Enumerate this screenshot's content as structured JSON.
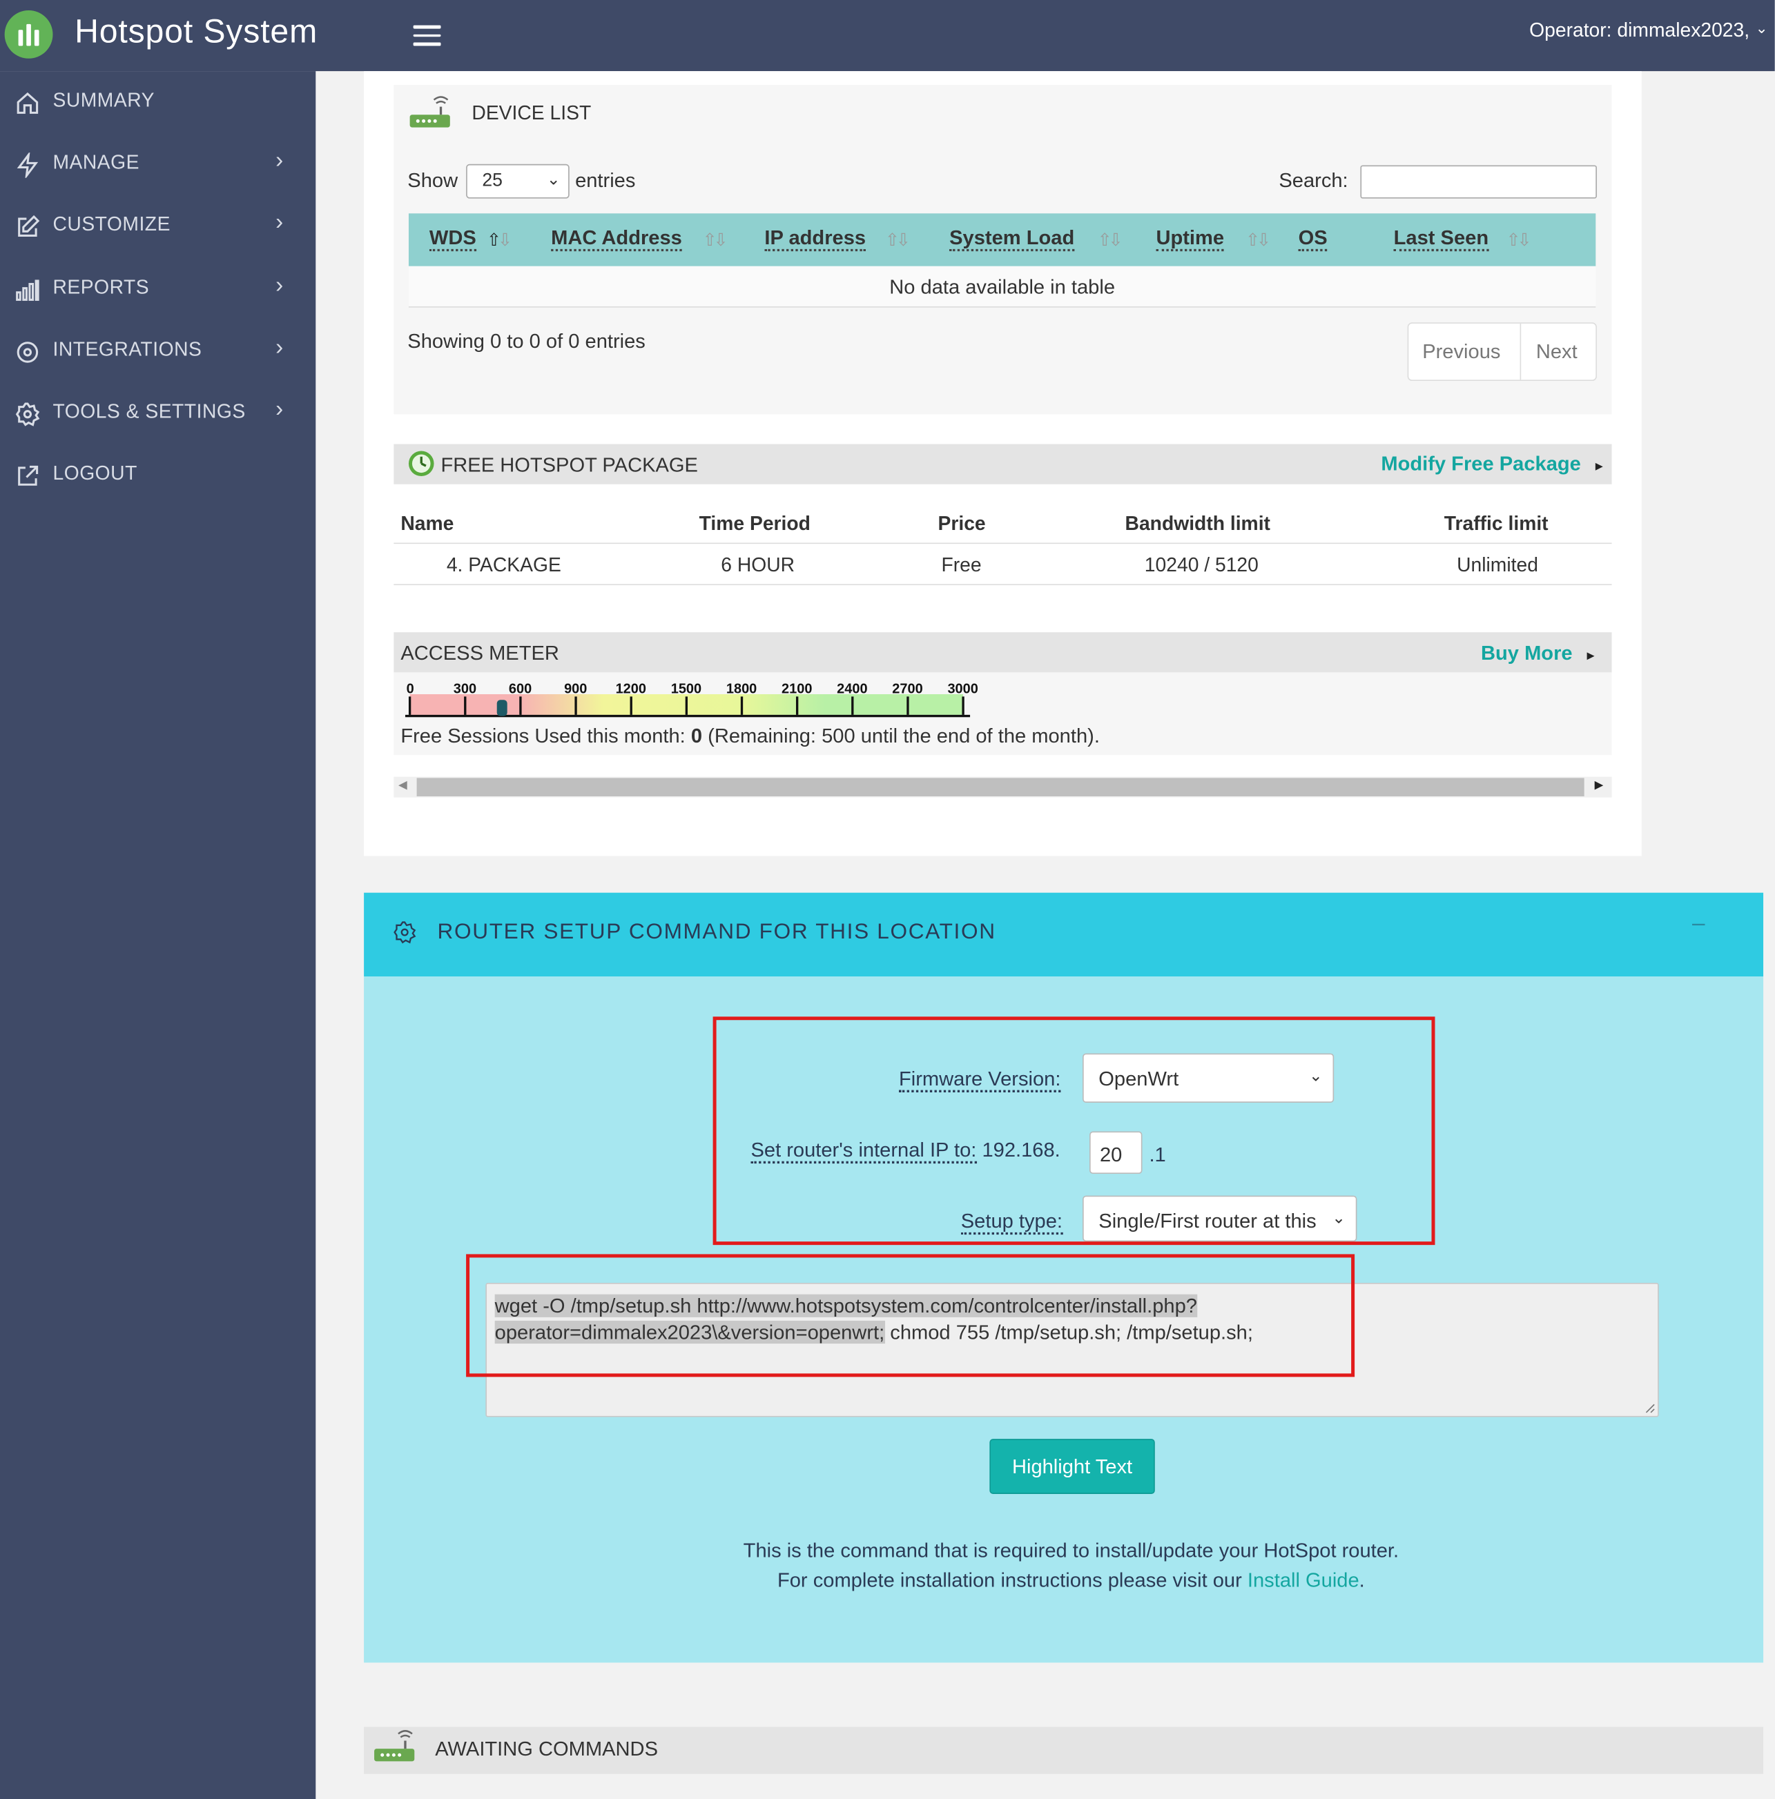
{
  "app": {
    "title": "Hotspot System",
    "operator": "Operator: dimmalex2023,"
  },
  "sidebar": {
    "items": [
      {
        "label": "SUMMARY",
        "icon": "home-icon"
      },
      {
        "label": "MANAGE",
        "icon": "lightning-icon"
      },
      {
        "label": "CUSTOMIZE",
        "icon": "edit-icon"
      },
      {
        "label": "REPORTS",
        "icon": "bar-chart-icon"
      },
      {
        "label": "INTEGRATIONS",
        "icon": "target-icon"
      },
      {
        "label": "TOOLS & SETTINGS",
        "icon": "gear-icon"
      },
      {
        "label": "LOGOUT",
        "icon": "external-link-icon"
      }
    ]
  },
  "device_list": {
    "title": "DEVICE LIST",
    "show_label": "Show",
    "entries_value": "25",
    "entries_label": "entries",
    "search_label": "Search:",
    "search_value": "",
    "columns": [
      "WDS",
      "MAC Address",
      "IP address",
      "System Load",
      "Uptime",
      "OS",
      "Last Seen"
    ],
    "sort_icon": "⇧⇩",
    "empty_text": "No data available in table",
    "info_text": "Showing 0 to 0 of 0 entries",
    "prev_label": "Previous",
    "next_label": "Next"
  },
  "free_package": {
    "title": "FREE HOTSPOT PACKAGE",
    "modify_label": "Modify Free Package",
    "columns": [
      "Name",
      "Time Period",
      "Price",
      "Bandwidth limit",
      "Traffic limit"
    ],
    "row": [
      "4. PACKAGE",
      "6 HOUR",
      "Free",
      "10240 / 5120",
      "Unlimited"
    ]
  },
  "access_meter": {
    "title": "ACCESS METER",
    "buy_label": "Buy More",
    "scale_labels": [
      "0",
      "300",
      "600",
      "900",
      "1200",
      "1500",
      "1800",
      "2100",
      "2400",
      "2700",
      "3000"
    ],
    "marker_value": 500,
    "sessions_prefix": "Free Sessions Used this month:",
    "sessions_used": "0",
    "sessions_suffix": "(Remaining: 500 until the end of the month)."
  },
  "router_setup": {
    "title": "ROUTER SETUP COMMAND FOR THIS LOCATION",
    "minimize": "–",
    "firmware_label": "Firmware Version:",
    "firmware_value": "OpenWrt",
    "ip_label_dotted": "Set router's internal IP to:",
    "ip_prefix": "192.168.",
    "ip_value": "20",
    "ip_suffix": ".1",
    "setup_type_label": "Setup type:",
    "setup_type_value": "Single/First router at this",
    "command_line1": "wget -O /tmp/setup.sh http://www.hotspotsystem.com/controlcenter/install.php?",
    "command_line2_hl": "operator=dimmalex2023\\&version=openwrt;",
    "command_line2_rest": " chmod 755 /tmp/setup.sh; /tmp/setup.sh;",
    "highlight_button": "Highlight Text",
    "info_line1": "This is the command that is required to install/update your HotSpot router.",
    "info_line2": "For complete installation instructions please visit our",
    "install_link": "Install Guide",
    "info_period": "."
  },
  "awaiting": {
    "title": "AWAITING COMMANDS"
  },
  "colors": {
    "header_bg": "#3f4a67",
    "table_header": "#8fd0cf",
    "teal_link": "#14a6a0",
    "router_header": "#2fcbe2",
    "router_body": "#a7e7f0",
    "annotation_red": "#e21b1b"
  }
}
